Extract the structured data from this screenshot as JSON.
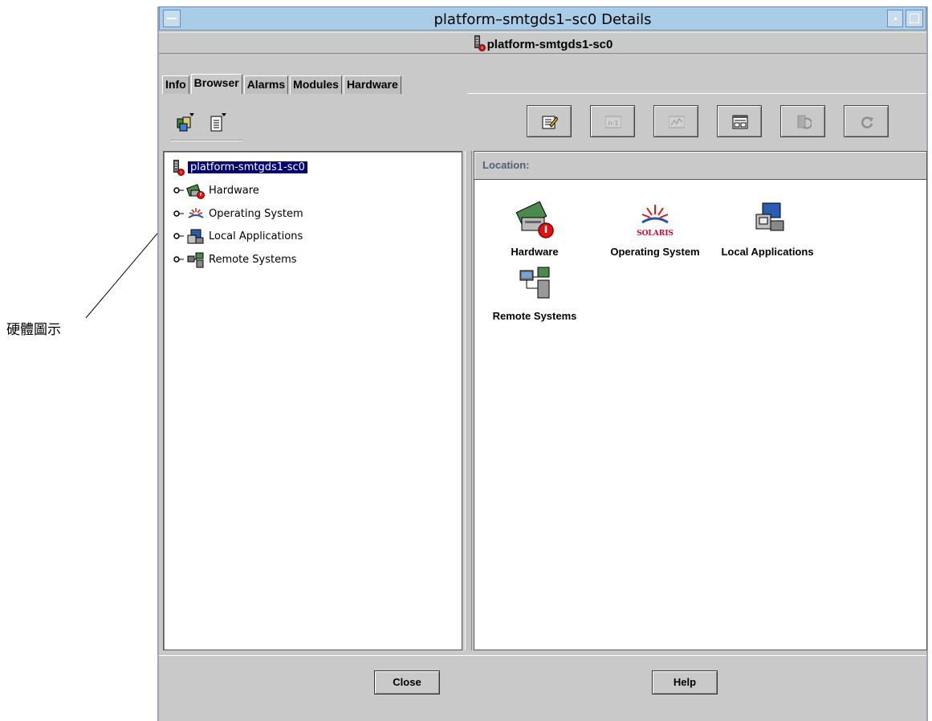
{
  "window": {
    "title": "platform–smtgds1–sc0 Details",
    "header": "platform-smtgds1-sc0"
  },
  "tabs": [
    {
      "label": "Info"
    },
    {
      "label": "Browser"
    },
    {
      "label": "Alarms"
    },
    {
      "label": "Modules"
    },
    {
      "label": "Hardware"
    }
  ],
  "active_tab": "Browser",
  "tree": {
    "root": "platform-smtgds1-sc0",
    "items": [
      {
        "label": "Hardware",
        "icon": "hardware-icon"
      },
      {
        "label": "Operating System",
        "icon": "solaris-icon"
      },
      {
        "label": "Local Applications",
        "icon": "local-applications-icon"
      },
      {
        "label": "Remote Systems",
        "icon": "remote-systems-icon"
      }
    ]
  },
  "location": {
    "label": "Location:"
  },
  "grid": [
    {
      "label": "Hardware",
      "icon": "hardware-icon"
    },
    {
      "label": "Operating System",
      "icon": "solaris-icon",
      "logo_text": "SOLARIS"
    },
    {
      "label": "Local Applications",
      "icon": "local-applications-icon"
    },
    {
      "label": "Remote Systems",
      "icon": "remote-systems-icon"
    }
  ],
  "toolbar": {
    "left": [
      "view-selector-icon",
      "properties-list-icon"
    ],
    "right": [
      {
        "icon": "edit-attributes-icon",
        "text": "",
        "enabled": true
      },
      {
        "icon": "n-1-icon",
        "text": "n-1",
        "enabled": false
      },
      {
        "icon": "graph-icon",
        "text": "",
        "enabled": false
      },
      {
        "icon": "table-view-icon",
        "text": "",
        "enabled": true
      },
      {
        "icon": "refresh-data-icon",
        "text": "",
        "enabled": false
      },
      {
        "icon": "reload-icon",
        "text": "",
        "enabled": false
      }
    ]
  },
  "buttons": {
    "close": "Close",
    "help": "Help"
  },
  "annotation": {
    "label": "硬體圖示"
  }
}
